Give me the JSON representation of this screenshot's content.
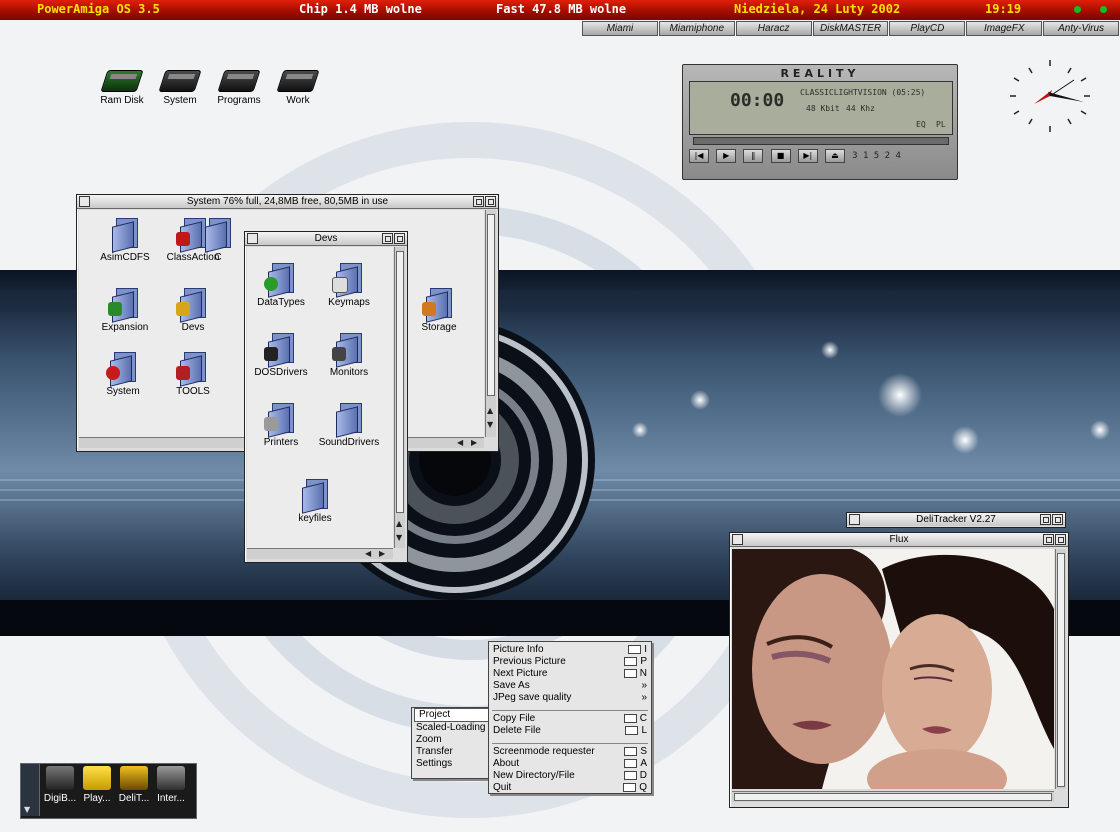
{
  "topbar": {
    "os_title": "PowerAmiga OS 3.5",
    "chip_mem": "Chip 1.4 MB wolne",
    "fast_mem": "Fast 47.8 MB wolne",
    "date": "Niedziela, 24 Luty 2002",
    "time": "19:19"
  },
  "launcher_tabs": [
    "Miami",
    "Miamiphone",
    "Haracz",
    "DiskMASTER",
    "PlayCD",
    "ImageFX",
    "Anty-Virus"
  ],
  "desktop_icons": [
    {
      "label": "Ram Disk",
      "icon": "ram-disk-icon"
    },
    {
      "label": "System",
      "icon": "hard-drive-icon"
    },
    {
      "label": "Programs",
      "icon": "hard-drive-icon"
    },
    {
      "label": "Work",
      "icon": "hard-drive-icon"
    }
  ],
  "system_window": {
    "title": "System  76% full, 24,8MB free, 80,5MB in use",
    "icons": [
      {
        "label": "AsimCDFS",
        "icon": "folder-icon"
      },
      {
        "label": "ClassAction",
        "icon": "folder-icon"
      },
      {
        "label": "Expansion",
        "icon": "folder-icon"
      },
      {
        "label": "Devs",
        "icon": "folder-icon"
      },
      {
        "label": "Storage",
        "icon": "folder-icon"
      },
      {
        "label": "System",
        "icon": "folder-icon"
      },
      {
        "label": "TOOLS",
        "icon": "folder-icon"
      }
    ],
    "partial_label": "C"
  },
  "devs_window": {
    "title": "Devs",
    "icons": [
      {
        "label": "DataTypes",
        "icon": "folder-icon"
      },
      {
        "label": "Keymaps",
        "icon": "folder-icon"
      },
      {
        "label": "DOSDrivers",
        "icon": "folder-icon"
      },
      {
        "label": "Monitors",
        "icon": "folder-icon"
      },
      {
        "label": "Printers",
        "icon": "folder-icon"
      },
      {
        "label": "SoundDrivers",
        "icon": "folder-icon"
      },
      {
        "label": "keyfiles",
        "icon": "folder-icon"
      }
    ]
  },
  "reality_player": {
    "logo": "REALITY",
    "time_display": "00:00",
    "track_title": "CLASSICLIGHTVISION (05:25)",
    "bitrate": "48 Kbit",
    "samplerate": "44 Khz",
    "eq_label": "EQ",
    "pl_label": "PL",
    "sequence": "3 1 5 2 4"
  },
  "delitracker": {
    "title": "DeliTracker V2.27"
  },
  "flux_window": {
    "title": "Flux"
  },
  "project_menu": {
    "items": [
      "Project",
      "Scaled-Loading",
      "Zoom",
      "Transfer",
      "Settings"
    ],
    "selected": "Project"
  },
  "project_submenu": {
    "groups": [
      [
        {
          "label": "Picture Info",
          "key": "I"
        },
        {
          "label": "Previous Picture",
          "key": "P"
        },
        {
          "label": "Next Picture",
          "key": "N"
        },
        {
          "label": "Save As",
          "key": "»"
        },
        {
          "label": "JPeg save quality",
          "key": "»"
        }
      ],
      [
        {
          "label": "Copy File",
          "key": "C"
        },
        {
          "label": "Delete File",
          "key": "L"
        }
      ],
      [
        {
          "label": "Screenmode requester",
          "key": "S"
        },
        {
          "label": "About",
          "key": "A"
        },
        {
          "label": "New Directory/File",
          "key": "D"
        },
        {
          "label": "Quit",
          "key": "Q"
        }
      ]
    ]
  },
  "dock": {
    "items": [
      "DigiB...",
      "Play...",
      "DeliT...",
      "Inter..."
    ]
  },
  "colors": {
    "topbar_red": "#a60d00",
    "topbar_yellow": "#ffe100",
    "status_green": "#10c020",
    "folder_blue": "#7d92c8"
  }
}
